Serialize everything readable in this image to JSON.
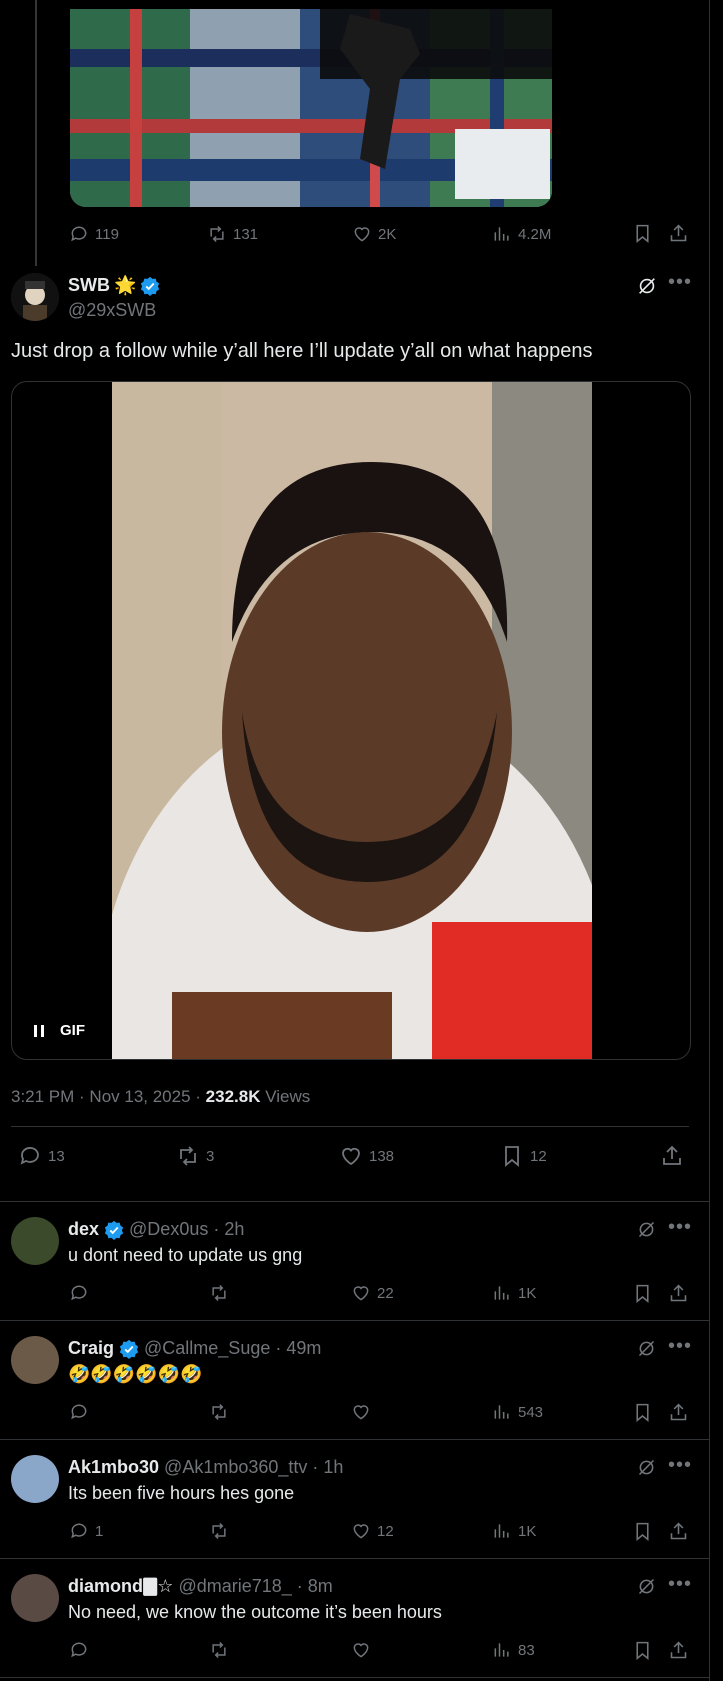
{
  "top_tweet": {
    "stats": {
      "replies": "119",
      "reposts": "131",
      "likes": "2K",
      "views": "4.2M"
    }
  },
  "main_tweet": {
    "name": "SWB",
    "name_emoji": "🌟",
    "handle": "@29xSWB",
    "text": "Just drop a follow while y’all here I’ll update y’all on what happens",
    "gif_label": "GIF",
    "timestamp": "3:21 PM · Nov 13, 2025 · ",
    "views_count": "232.8K",
    "views_label": " Views",
    "stats": {
      "replies": "13",
      "reposts": "3",
      "likes": "138",
      "bookmarks": "12"
    }
  },
  "replies": [
    {
      "name": "dex",
      "verified": true,
      "handle": "@Dex0us",
      "time": "· 2h",
      "text": "u dont need to update us gng",
      "stats": {
        "replies": "",
        "reposts": "",
        "likes": "22",
        "views": "1K"
      }
    },
    {
      "name": "Craig",
      "verified": true,
      "handle": "@Callme_Suge",
      "time": "· 49m",
      "text": "🤣🤣🤣🤣🤣🤣",
      "stats": {
        "replies": "",
        "reposts": "",
        "likes": "",
        "views": "543"
      }
    },
    {
      "name": "Ak1mbo30",
      "verified": false,
      "handle": "@Ak1mbo360_ttv",
      "time": "· 1h",
      "text": "Its been five hours hes gone",
      "stats": {
        "replies": "1",
        "reposts": "",
        "likes": "12",
        "views": "1K"
      }
    },
    {
      "name": "diamond🀫☆",
      "verified": false,
      "handle": "@dmarie718_",
      "time": "· 8m",
      "text": "No need, we know the outcome it’s been hours",
      "stats": {
        "replies": "",
        "reposts": "",
        "likes": "",
        "views": "83"
      }
    }
  ],
  "colors": {
    "background": "#000000",
    "text": "#e7e9ea",
    "muted": "#71767b",
    "verified": "#1d9bf0",
    "divider": "#2f3336"
  }
}
